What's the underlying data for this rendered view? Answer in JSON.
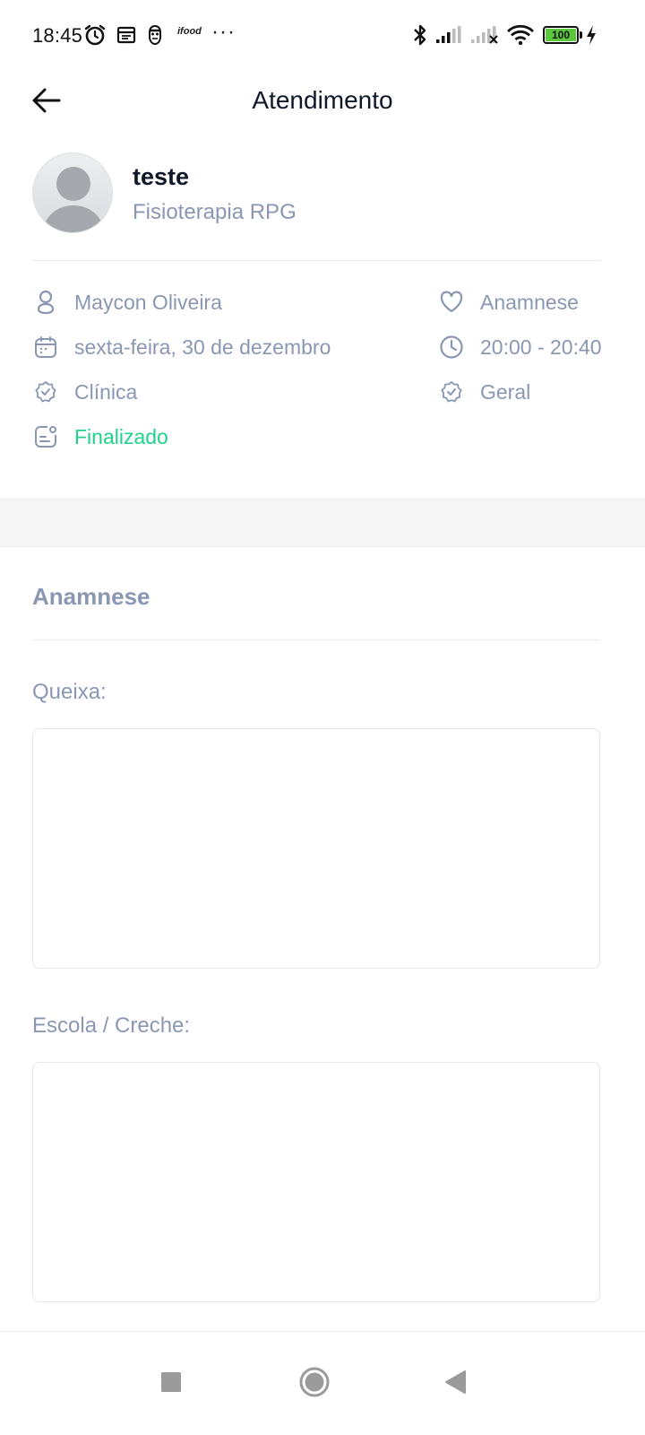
{
  "status_bar": {
    "time": "18:45",
    "app_badge": "ifood",
    "more": "···",
    "battery_level": "100",
    "icons": [
      "alarm-icon",
      "calendar-app-icon",
      "face-app-icon",
      "ifood-icon",
      "bluetooth-icon",
      "signal-icon",
      "signal-off-icon",
      "wifi-icon",
      "battery-icon",
      "charging-icon"
    ]
  },
  "header": {
    "title": "Atendimento",
    "back_icon": "arrow-left-icon"
  },
  "patient": {
    "name": "teste",
    "specialty": "Fisioterapia RPG",
    "avatar_icon": "user-placeholder-avatar"
  },
  "details": {
    "professional": "Maycon Oliveira",
    "date": "sexta-feira, 30 de dezembro",
    "location": "Clínica",
    "status": "Finalizado",
    "form_type": "Anamnese",
    "time_range": "20:00 - 20:40",
    "category": "Geral",
    "status_color": "#1fd18a"
  },
  "form": {
    "section_title": "Anamnese",
    "fields": [
      {
        "label": "Queixa:",
        "value": ""
      },
      {
        "label": "Escola / Creche:",
        "value": ""
      }
    ]
  },
  "nav_bar": {
    "icons": [
      "recent-apps-icon",
      "home-icon",
      "back-triangle-icon"
    ]
  },
  "colors": {
    "muted_text": "#8a97b3",
    "title_text": "#0f172a",
    "success": "#1fd18a",
    "band": "#f6f6f7"
  }
}
